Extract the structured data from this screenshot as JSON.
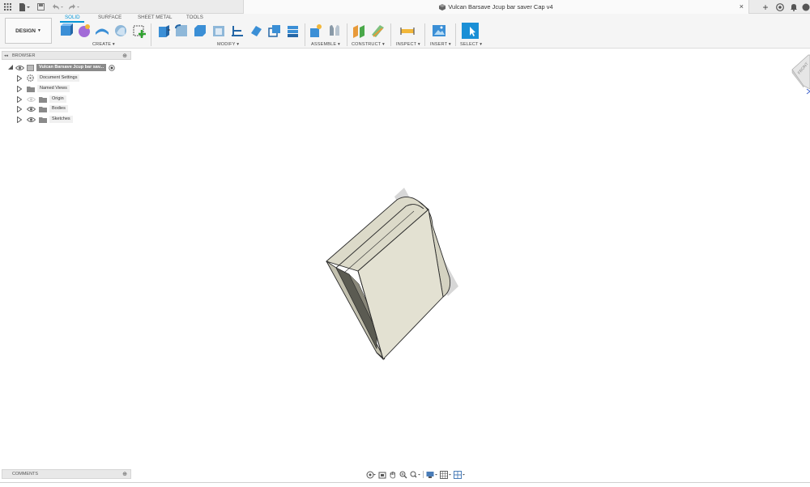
{
  "titlebar": {
    "document_title": "Vulcan Barsave Jcup bar saver Cap v4",
    "close_symbol": "×",
    "new_tab_symbol": "+"
  },
  "toolbar": {
    "workspace_label": "DESIGN",
    "tabs": [
      "SOLID",
      "SURFACE",
      "SHEET METAL",
      "TOOLS"
    ],
    "active_tab": "SOLID",
    "groups": [
      "CREATE",
      "MODIFY",
      "ASSEMBLE",
      "CONSTRUCT",
      "INSPECT",
      "INSERT",
      "SELECT"
    ],
    "accent_color": "#0696d7"
  },
  "browser": {
    "header_label": "BROWSER",
    "root_label": "Vulcan Barsave Jcup bar sav...",
    "items": [
      {
        "label": "Document Settings",
        "icon": "gear-icon"
      },
      {
        "label": "Named Views",
        "icon": "folder-icon"
      },
      {
        "label": "Origin",
        "icon": "folder-icon"
      },
      {
        "label": "Bodies",
        "icon": "folder-icon"
      },
      {
        "label": "Sketches",
        "icon": "folder-icon"
      }
    ]
  },
  "comments": {
    "label": "COMMENTS"
  },
  "viewcube": {
    "face_label": "FRONT"
  },
  "model": {
    "body_color": "#e3e1d2",
    "edge_color": "#2a2a2a"
  }
}
